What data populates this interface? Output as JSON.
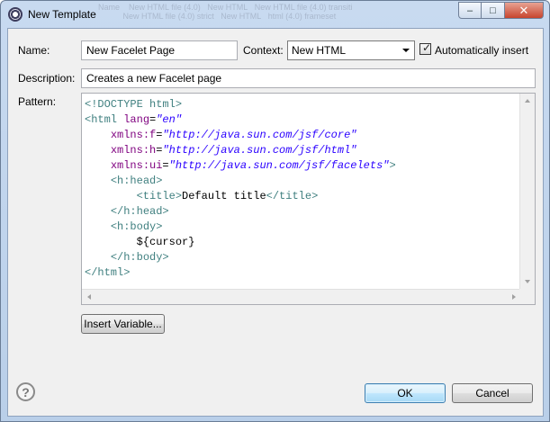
{
  "window": {
    "title": "New Template",
    "background_items": [
      "Name",
      "New HTML file (4.0)",
      "New HTML",
      "New HTML file (4.0) transiti",
      "New HTML file (4.0) strict",
      "New HTML",
      "html (4.0) frameset"
    ]
  },
  "form": {
    "name_label": "Name:",
    "name_value": "New Facelet Page",
    "context_label": "Context:",
    "context_value": "New HTML",
    "auto_insert_label": "Automatically insert",
    "auto_insert_checked": true,
    "description_label": "Description:",
    "description_value": "Creates a new Facelet page",
    "pattern_label": "Pattern:"
  },
  "pattern": {
    "lines": [
      [
        {
          "t": "tag",
          "v": "<!DOCTYPE html>"
        }
      ],
      [
        {
          "t": "tag",
          "v": "<html "
        },
        {
          "t": "attr",
          "v": "lang"
        },
        {
          "t": "txt",
          "v": "="
        },
        {
          "t": "str",
          "v": "\"en\""
        }
      ],
      [
        {
          "t": "txt",
          "v": "    "
        },
        {
          "t": "attr",
          "v": "xmlns:f"
        },
        {
          "t": "txt",
          "v": "="
        },
        {
          "t": "str",
          "v": "\"http://java.sun.com/jsf/core\""
        }
      ],
      [
        {
          "t": "txt",
          "v": "    "
        },
        {
          "t": "attr",
          "v": "xmlns:h"
        },
        {
          "t": "txt",
          "v": "="
        },
        {
          "t": "str",
          "v": "\"http://java.sun.com/jsf/html\""
        }
      ],
      [
        {
          "t": "txt",
          "v": "    "
        },
        {
          "t": "attr",
          "v": "xmlns:ui"
        },
        {
          "t": "txt",
          "v": "="
        },
        {
          "t": "str",
          "v": "\"http://java.sun.com/jsf/facelets\""
        },
        {
          "t": "tag",
          "v": ">"
        }
      ],
      [
        {
          "t": "txt",
          "v": "    "
        },
        {
          "t": "tag",
          "v": "<h:head>"
        }
      ],
      [
        {
          "t": "txt",
          "v": "        "
        },
        {
          "t": "tag",
          "v": "<title>"
        },
        {
          "t": "txt",
          "v": "Default title"
        },
        {
          "t": "tag",
          "v": "</title>"
        }
      ],
      [
        {
          "t": "txt",
          "v": "    "
        },
        {
          "t": "tag",
          "v": "</h:head>"
        }
      ],
      [
        {
          "t": "txt",
          "v": "    "
        },
        {
          "t": "tag",
          "v": "<h:body>"
        }
      ],
      [
        {
          "t": "txt",
          "v": "        ${cursor}"
        }
      ],
      [
        {
          "t": "txt",
          "v": "    "
        },
        {
          "t": "tag",
          "v": "</h:body>"
        }
      ],
      [
        {
          "t": "tag",
          "v": "</html>"
        }
      ]
    ]
  },
  "buttons": {
    "insert_variable": "Insert Variable...",
    "ok": "OK",
    "cancel": "Cancel"
  },
  "icons": {
    "window_icon": "eclipse-icon",
    "help": "help-icon",
    "help_glyph": "?"
  }
}
